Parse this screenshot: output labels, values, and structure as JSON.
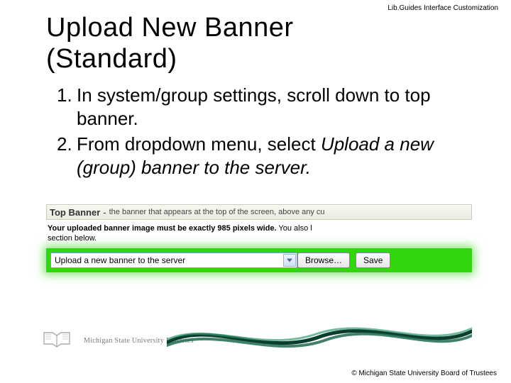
{
  "header_right": "Lib.Guides Interface Customization",
  "title_line1": "Upload New Banner",
  "title_line2": "(Standard)",
  "steps": {
    "n1": "1.",
    "t1": "In system/group settings, scroll down to top banner.",
    "n2": "2.",
    "t2a": "From dropdown menu, select ",
    "t2b": "Upload a new (group) banner to the server."
  },
  "screenshot": {
    "section_title": "Top Banner",
    "section_dash": "-",
    "section_desc": "the banner that appears at the top of the screen, above any cu",
    "req_bold": "Your uploaded banner image must be exactly 985 pixels wide.",
    "req_tail": " You also l",
    "section_below": "section below.",
    "dropdown_value": "Upload a new banner to the server",
    "browse_label": "Browse…",
    "save_label": "Save"
  },
  "footer_library": "Michigan State University Libraries",
  "copyright": "© Michigan State University Board of Trustees"
}
